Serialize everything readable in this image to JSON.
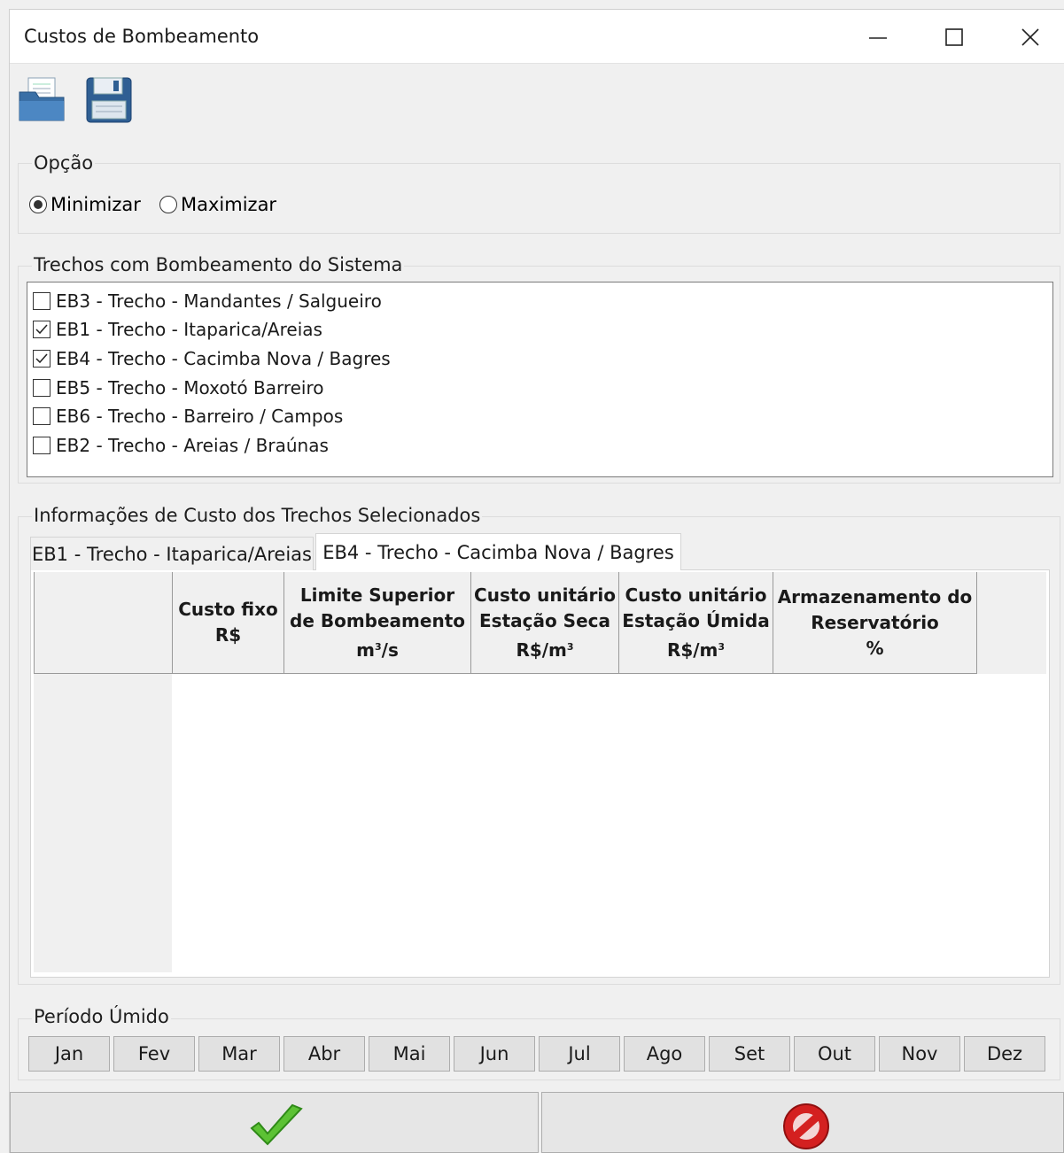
{
  "window": {
    "title": "Custos de Bombeamento"
  },
  "toolbar": {
    "open_icon": "open-folder-icon",
    "save_icon": "floppy-disk-save-icon"
  },
  "opcao": {
    "label": "Opção",
    "options": [
      {
        "label": "Minimizar",
        "selected": true
      },
      {
        "label": "Maximizar",
        "selected": false
      }
    ]
  },
  "trechos": {
    "label": "Trechos com Bombeamento do Sistema",
    "items": [
      {
        "label": "EB3 - Trecho - Mandantes / Salgueiro",
        "checked": false
      },
      {
        "label": "EB1 - Trecho - Itaparica/Areias",
        "checked": true
      },
      {
        "label": "EB4 - Trecho - Cacimba Nova / Bagres",
        "checked": true
      },
      {
        "label": "EB5 - Trecho - Moxotó Barreiro",
        "checked": false
      },
      {
        "label": "EB6 - Trecho - Barreiro / Campos",
        "checked": false
      },
      {
        "label": "EB2 - Trecho - Areias / Braúnas",
        "checked": false
      }
    ]
  },
  "info": {
    "label": "Informações de Custo dos Trechos Selecionados",
    "tabs": [
      {
        "label": "EB1 - Trecho - Itaparica/Areias",
        "active": false
      },
      {
        "label": "EB4 - Trecho - Cacimba Nova / Bagres",
        "active": true
      }
    ],
    "columns": {
      "custo_fixo": {
        "l1": "Custo fixo",
        "l2": "R$"
      },
      "limite": {
        "l1": "Limite Superior",
        "l2": "de Bombeamento",
        "l3a": "m",
        "sup": "3",
        "l3b": "/s"
      },
      "seca": {
        "l1": "Custo unitário",
        "l2": "Estação Seca",
        "l3a": "R$/m",
        "sup": "3"
      },
      "umida": {
        "l1": "Custo unitário",
        "l2": "Estação Úmida",
        "l3a": "R$/m",
        "sup": "3"
      },
      "armaz": {
        "l1": "Armazenamento do",
        "l2": "Reservatório",
        "l3": "%"
      }
    }
  },
  "periodo": {
    "label": "Período Úmido",
    "months": [
      "Jan",
      "Fev",
      "Mar",
      "Abr",
      "Mai",
      "Jun",
      "Jul",
      "Ago",
      "Set",
      "Out",
      "Nov",
      "Dez"
    ]
  },
  "actions": {
    "ok_icon": "green-checkmark-icon",
    "cancel_icon": "red-prohibited-icon"
  }
}
